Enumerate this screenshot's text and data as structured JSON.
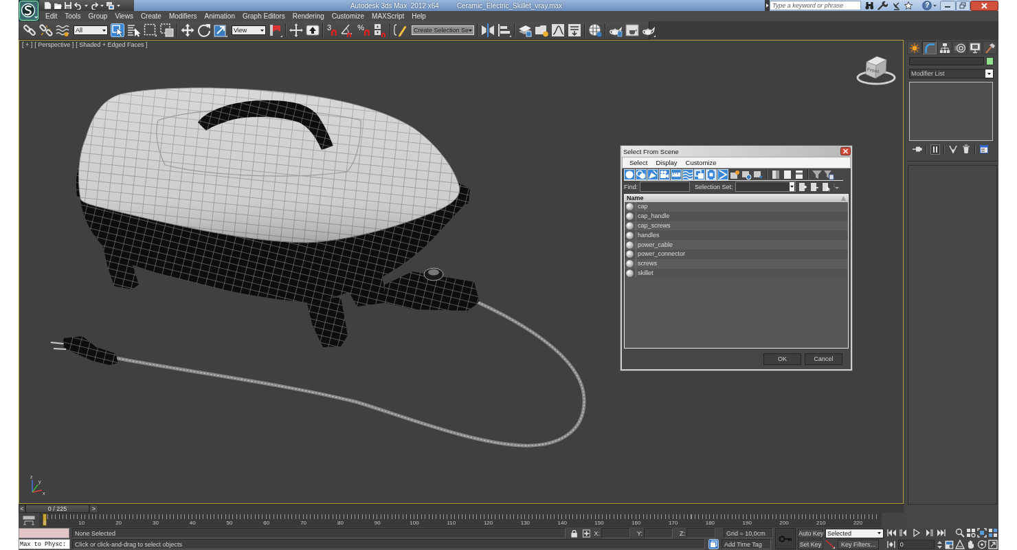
{
  "window": {
    "title": "Autodesk 3ds Max  2012 x64",
    "file": "Ceramic_Electric_Skillet_vray.max",
    "search_placeholder": "Type a keyword or phrase",
    "help": "?"
  },
  "menu": [
    "Edit",
    "Tools",
    "Group",
    "Views",
    "Create",
    "Modifiers",
    "Animation",
    "Graph Editors",
    "Rendering",
    "Customize",
    "MAXScript",
    "Help"
  ],
  "main_toolbar": [
    {
      "kind": "button",
      "selected": false
    },
    {
      "kind": "button",
      "selected": false
    },
    {
      "kind": "button",
      "selected": false
    },
    {
      "kind": "dropdown",
      "value": "All"
    },
    {
      "kind": "button",
      "selected": true
    },
    {
      "kind": "button",
      "selected": false
    },
    {
      "kind": "button",
      "selected": false
    },
    {
      "kind": "button",
      "selected": false
    },
    {
      "kind": "button",
      "selected": false
    },
    {
      "kind": "button",
      "selected": false
    },
    {
      "kind": "button",
      "selected": false
    },
    {
      "kind": "dropdown",
      "value": "View"
    },
    {
      "kind": "button",
      "selected": false
    },
    {
      "kind": "button",
      "selected": false
    },
    {
      "kind": "button",
      "selected": false
    },
    {
      "kind": "snap",
      "label": "3",
      "selected": false
    },
    {
      "kind": "button",
      "selected": false
    },
    {
      "kind": "snap",
      "label": "%",
      "selected": false
    },
    {
      "kind": "button",
      "selected": false
    },
    {
      "kind": "button",
      "selected": false
    },
    {
      "kind": "dropdown",
      "value": "Create Selection Se"
    },
    {
      "kind": "button",
      "selected": false
    },
    {
      "kind": "button",
      "selected": false
    },
    {
      "kind": "button",
      "selected": false
    },
    {
      "kind": "button",
      "selected": false
    },
    {
      "kind": "button",
      "selected": false
    },
    {
      "kind": "button",
      "selected": false
    },
    {
      "kind": "button",
      "selected": false
    },
    {
      "kind": "button",
      "selected": false
    },
    {
      "kind": "button",
      "selected": false
    },
    {
      "kind": "button",
      "selected": false
    }
  ],
  "viewport": {
    "active": true,
    "labels": [
      "[ + ]",
      "[ Perspective ]",
      "[ Shaded + Edged Faces ]"
    ],
    "view_cube": "Front",
    "axis_labels": [
      "z",
      "y",
      "x"
    ]
  },
  "dialog": {
    "title": "Select From Scene",
    "menu": [
      "Select",
      "Display",
      "Customize"
    ],
    "filters": [
      {
        "selected": true
      },
      {
        "selected": true
      },
      {
        "selected": true
      },
      {
        "selected": true
      },
      {
        "selected": true
      },
      {
        "selected": true
      },
      {
        "selected": true
      },
      {
        "selected": true
      },
      {
        "selected": true
      }
    ],
    "find_label": "Find:",
    "selection_set_label": "Selection Set:",
    "column": "Name",
    "rows": [
      {
        "name": "cap",
        "selected": false
      },
      {
        "name": "cap_handle",
        "selected": false
      },
      {
        "name": "cap_screws",
        "selected": false
      },
      {
        "name": "handles",
        "selected": false
      },
      {
        "name": "power_cable",
        "selected": false
      },
      {
        "name": "power_connector",
        "selected": false
      },
      {
        "name": "screws",
        "selected": false
      },
      {
        "name": "skillet",
        "selected": false
      }
    ],
    "buttons": [
      "OK",
      "Cancel"
    ]
  },
  "command_panel": {
    "tabs": [
      {
        "selected": false
      },
      {
        "selected": true
      },
      {
        "selected": false
      },
      {
        "selected": false
      },
      {
        "selected": false
      },
      {
        "selected": false
      }
    ],
    "modifier_list": "Modifier List",
    "stack_buttons": [
      {
        "selected": false
      },
      {
        "selected": true
      },
      {
        "selected": false
      },
      {
        "selected": false
      },
      {
        "selected": false
      }
    ]
  },
  "time_slider": {
    "previous": "<",
    "reading": "0 / 225",
    "next": ">",
    "level": 0
  },
  "track_bar": {
    "labels": [
      "0",
      "10",
      "20",
      "30",
      "40",
      "50",
      "60",
      "70",
      "80",
      "90",
      "100",
      "110",
      "120",
      "130",
      "140",
      "150",
      "160",
      "170",
      "180",
      "190",
      "200",
      "210",
      "220"
    ]
  },
  "status_bar": {
    "listener_input": "Max to Physc:",
    "selection": "None Selected",
    "prompt": "Click or click-and-drag to select objects",
    "coordinates": [
      {
        "label": "X:"
      },
      {
        "label": "Y:"
      },
      {
        "label": "Z:"
      }
    ],
    "grid": "Grid = 10,0cm",
    "time_tag": "Add Time Tag",
    "auto_key": {
      "label": "Auto Key",
      "on": false
    },
    "key_set": "Selected",
    "set_key": "Set Key",
    "key_filters": "Key Filters...",
    "frame": "0"
  }
}
